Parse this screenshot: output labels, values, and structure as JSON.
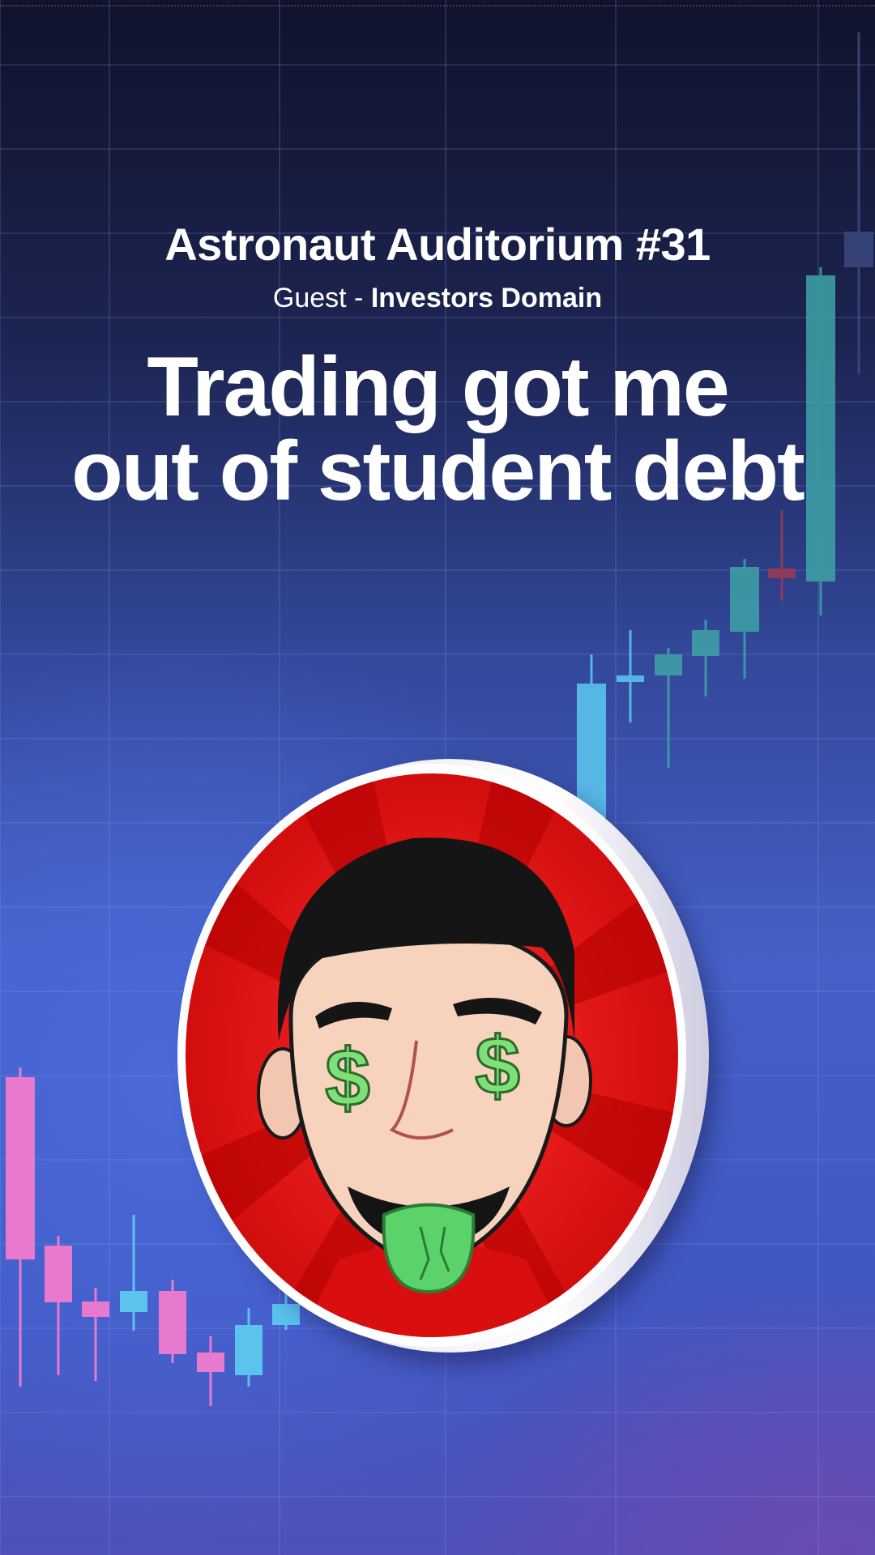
{
  "header": {
    "episode_title": "Astronaut Auditorium #31",
    "guest_label": "Guest - ",
    "guest_name": "Investors Domain"
  },
  "headline": {
    "line1": "Trading got me",
    "line2": "out of student debt"
  },
  "avatar": {
    "icon": "cartoon-face-money-eyes"
  },
  "colors": {
    "bullish_pink": "#f07ccf",
    "bullish_cyan": "#5cc9f0",
    "teal": "#3fa3a8",
    "dark_red": "#9c3a55",
    "coin_red": "#e01010"
  }
}
